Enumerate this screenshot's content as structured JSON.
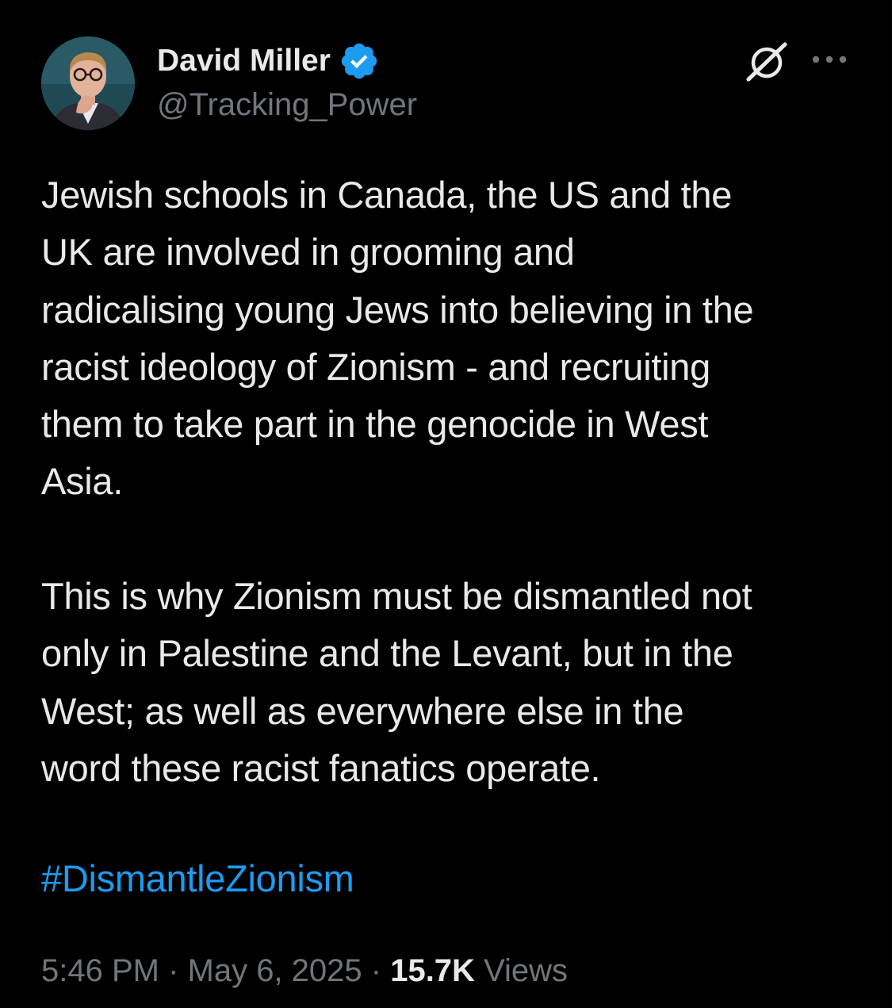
{
  "author": {
    "display_name": "David Miller",
    "handle": "@Tracking_Power",
    "verified": true,
    "verified_color": "#1d9bf0"
  },
  "header_actions": {
    "grok_icon": "grok-icon",
    "more_icon": "more-horizontal-icon"
  },
  "tweet": {
    "text": "Jewish schools in Canada, the US and the\nUK are involved in grooming and\nradicalising young Jews into believing in the\nracist ideology of Zionism - and recruiting\nthem to take part in the genocide in West\nAsia.\n\nThis is why Zionism must be dismantled not\nonly in Palestine and the Levant, but in the\nWest; as well as everywhere else in the\nword these racist fanatics operate.",
    "hashtag": "#DismantleZionism",
    "hashtag_color": "#1d9bf0"
  },
  "meta": {
    "time": "5:46 PM",
    "separator": " · ",
    "date": "May 6, 2025",
    "views_count": "15.7K",
    "views_label": " Views"
  },
  "colors": {
    "background": "#000000",
    "text_primary": "#e7e9ea",
    "text_secondary": "#71767b"
  }
}
